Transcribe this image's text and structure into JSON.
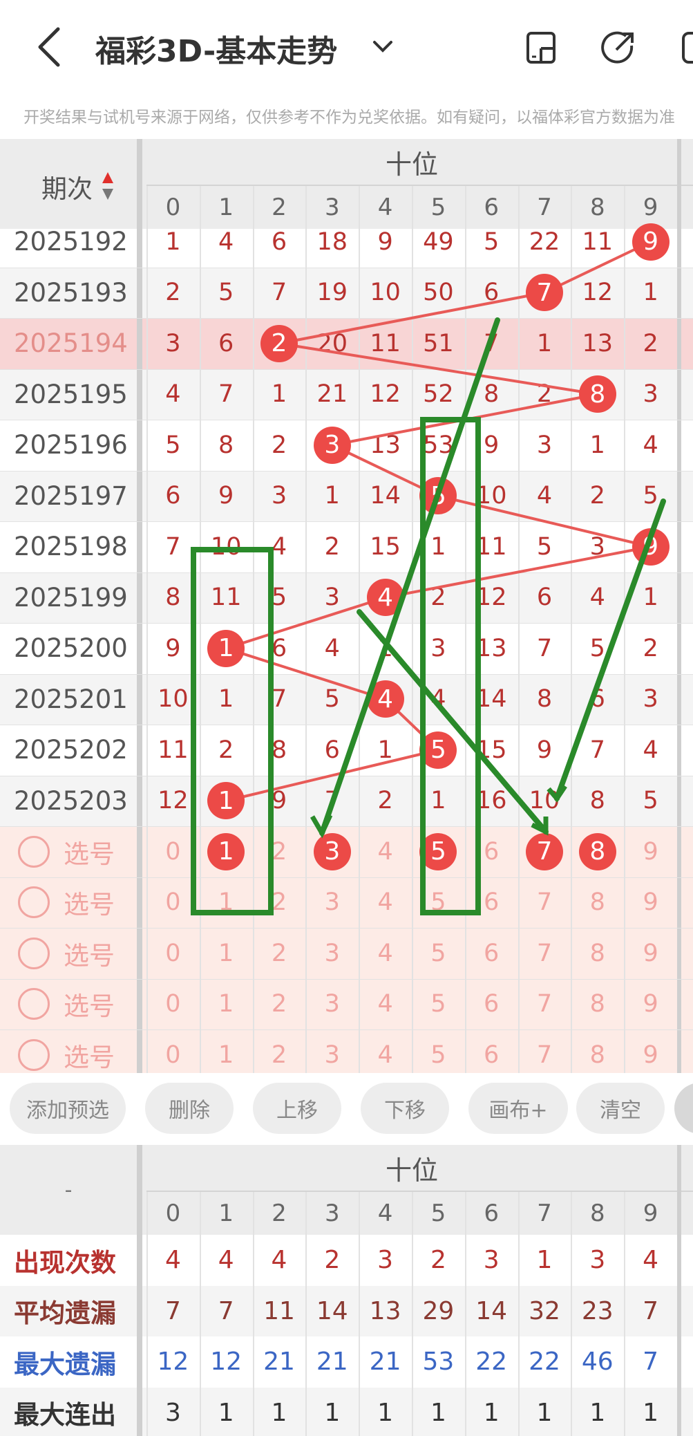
{
  "header": {
    "title": "福彩3D-基本走势",
    "notice": "开奖结果与试机号来源于网络，仅供参考不作为兑奖依据。如有疑问，以福体彩官方数据为准"
  },
  "table": {
    "period_label": "期次",
    "section_label": "十位",
    "digits": [
      "0",
      "1",
      "2",
      "3",
      "4",
      "5",
      "6",
      "7",
      "8",
      "9"
    ],
    "rows": [
      {
        "issue": "2025192",
        "cells": [
          "1",
          "4",
          "6",
          "18",
          "9",
          "49",
          "5",
          "22",
          "11",
          "9"
        ],
        "hit": 9
      },
      {
        "issue": "2025193",
        "cells": [
          "2",
          "5",
          "7",
          "19",
          "10",
          "50",
          "6",
          "7",
          "12",
          "1"
        ],
        "hit": 7
      },
      {
        "issue": "2025194",
        "cells": [
          "3",
          "6",
          "2",
          "20",
          "11",
          "51",
          "7",
          "1",
          "13",
          "2"
        ],
        "hit": 2
      },
      {
        "issue": "2025195",
        "cells": [
          "4",
          "7",
          "1",
          "21",
          "12",
          "52",
          "8",
          "2",
          "8",
          "3"
        ],
        "hit": 8
      },
      {
        "issue": "2025196",
        "cells": [
          "5",
          "8",
          "2",
          "3",
          "13",
          "53",
          "9",
          "3",
          "1",
          "4"
        ],
        "hit": 3
      },
      {
        "issue": "2025197",
        "cells": [
          "6",
          "9",
          "3",
          "1",
          "14",
          "5",
          "10",
          "4",
          "2",
          "5"
        ],
        "hit": 5
      },
      {
        "issue": "2025198",
        "cells": [
          "7",
          "10",
          "4",
          "2",
          "15",
          "1",
          "11",
          "5",
          "3",
          "9"
        ],
        "hit": 9
      },
      {
        "issue": "2025199",
        "cells": [
          "8",
          "11",
          "5",
          "3",
          "4",
          "2",
          "12",
          "6",
          "4",
          "1"
        ],
        "hit": 4
      },
      {
        "issue": "2025200",
        "cells": [
          "9",
          "1",
          "6",
          "4",
          "1",
          "3",
          "13",
          "7",
          "5",
          "2"
        ],
        "hit": 1
      },
      {
        "issue": "2025201",
        "cells": [
          "10",
          "1",
          "7",
          "5",
          "4",
          "4",
          "14",
          "8",
          "6",
          "3"
        ],
        "hit": 4
      },
      {
        "issue": "2025202",
        "cells": [
          "11",
          "2",
          "8",
          "6",
          "1",
          "5",
          "15",
          "9",
          "7",
          "4"
        ],
        "hit": 5
      },
      {
        "issue": "2025203",
        "cells": [
          "12",
          "1",
          "9",
          "7",
          "2",
          "1",
          "16",
          "10",
          "8",
          "5"
        ],
        "hit": 1
      }
    ],
    "pick_label": "选号",
    "pick_rows": [
      {
        "sel": [
          1,
          3,
          5,
          7,
          8
        ]
      },
      {
        "sel": []
      },
      {
        "sel": []
      },
      {
        "sel": []
      },
      {
        "sel": []
      }
    ],
    "highlight_row": 2
  },
  "buttons": [
    "添加预选",
    "删除",
    "上移",
    "下移",
    "画布+",
    "清空"
  ],
  "stats": {
    "corner": "-",
    "section_label": "十位",
    "rows": [
      {
        "label": "出现次数",
        "color": "#b8322f",
        "values": [
          "4",
          "4",
          "4",
          "2",
          "3",
          "2",
          "3",
          "1",
          "3",
          "4"
        ]
      },
      {
        "label": "平均遗漏",
        "color": "#8a3a32",
        "values": [
          "7",
          "7",
          "11",
          "14",
          "13",
          "29",
          "14",
          "32",
          "23",
          "7"
        ]
      },
      {
        "label": "最大遗漏",
        "color": "#3b66c4",
        "values": [
          "12",
          "12",
          "21",
          "21",
          "21",
          "53",
          "22",
          "22",
          "46",
          "7"
        ]
      },
      {
        "label": "最大连出",
        "color": "#333333",
        "values": [
          "3",
          "1",
          "1",
          "1",
          "1",
          "1",
          "1",
          "1",
          "1",
          "1"
        ]
      }
    ]
  },
  "colors": {
    "ball": "#ec4a47",
    "accent_red": "#b8322f",
    "annotation": "#2a8a2a"
  }
}
